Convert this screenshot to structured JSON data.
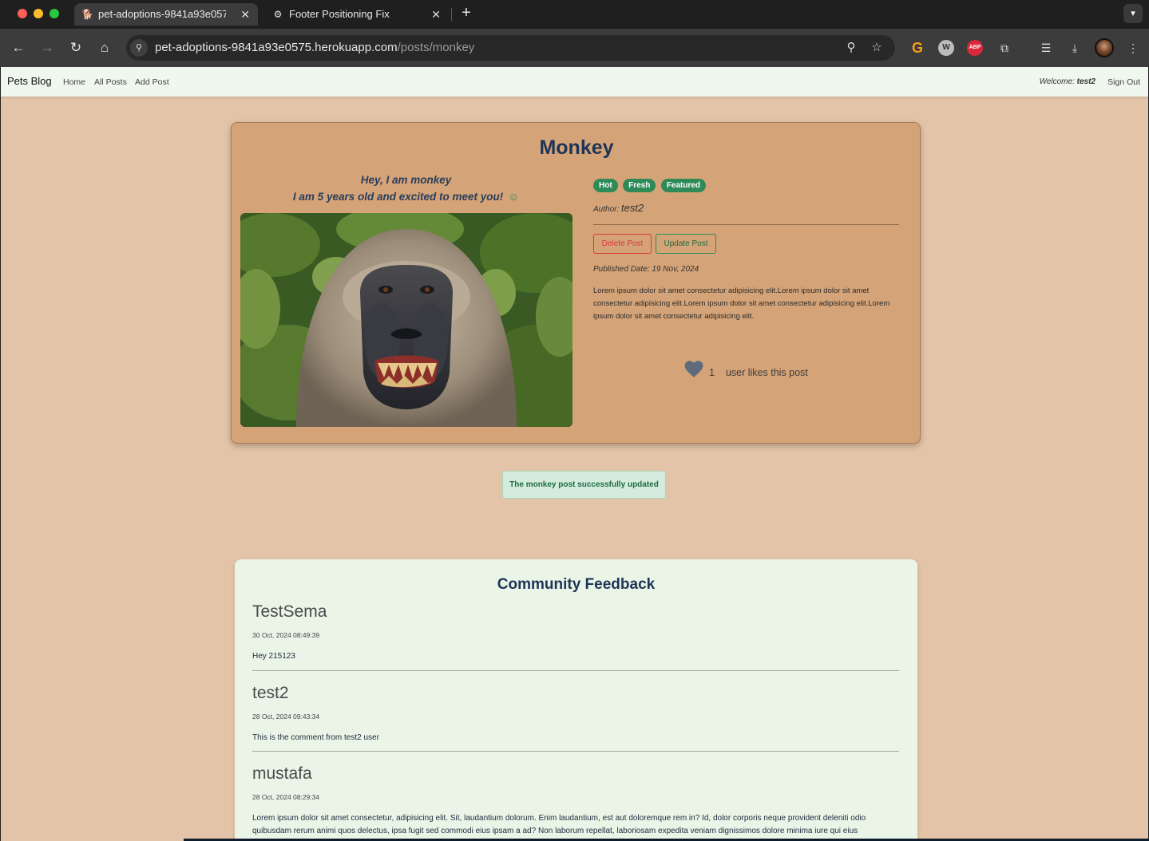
{
  "browser": {
    "tabs": [
      {
        "title": "pet-adoptions-9841a93e057",
        "favicon": "dog-icon",
        "active": true
      },
      {
        "title": "Footer Positioning Fix",
        "favicon": "openai-icon",
        "active": false
      }
    ],
    "url_host": "pet-adoptions-9841a93e0575.herokuapp.com",
    "url_path": "/posts/monkey"
  },
  "site_nav": {
    "brand": "Pets Blog",
    "links": [
      "Home",
      "All Posts",
      "Add Post"
    ],
    "welcome_label": "Welcome:",
    "welcome_user": "test2",
    "sign_out": "Sign Out"
  },
  "post": {
    "title": "Monkey",
    "intro_line1": "Hey, I am monkey",
    "intro_line2": "I am 5 years old and excited to meet you!",
    "badges": [
      "Hot",
      "Fresh",
      "Featured"
    ],
    "author_label": "Author:",
    "author_name": "test2",
    "delete_label": "Delete Post",
    "update_label": "Update Post",
    "published": "Published Date: 19 Nov, 2024",
    "body": "Lorem ipsum dolor sit amet consectetur adipisicing elit.Lorem ipsum dolor sit amet consectetur adipisicing elit.Lorem ipsum dolor sit amet consectetur adipisicing elit.Lorem ipsum dolor sit amet consectetur adipisicing elit.",
    "likes_count": "1",
    "likes_text": "user likes this post"
  },
  "flash": {
    "message": "The monkey post successfully updated"
  },
  "feedback": {
    "title": "Community Feedback",
    "comments": [
      {
        "name": "TestSema",
        "date": "30 Oct, 2024 08:49:39",
        "text": "Hey 215123"
      },
      {
        "name": "test2",
        "date": "28 Oct, 2024 09:43:34",
        "text": "This is the comment from test2 user"
      },
      {
        "name": "mustafa",
        "date": "28 Oct, 2024 08:29:34",
        "text": "Lorem ipsum dolor sit amet consectetur, adipisicing elit. Sit, laudantium dolorum. Enim laudantium, est aut doloremque rem in? Id, dolor corporis neque provident deleniti odio quibusdam rerum animi quos delectus, ipsa fugit sed commodi eius ipsam a ad? Non laborum repellat, laboriosam expedita veniam dignissimos dolore minima iure qui eius"
      }
    ]
  },
  "colors": {
    "page_bg": "#e3c4a8",
    "card_bg": "#d4a377",
    "accent_green": "#2e8b57",
    "danger": "#dc3545",
    "title_navy": "#1e3456"
  }
}
